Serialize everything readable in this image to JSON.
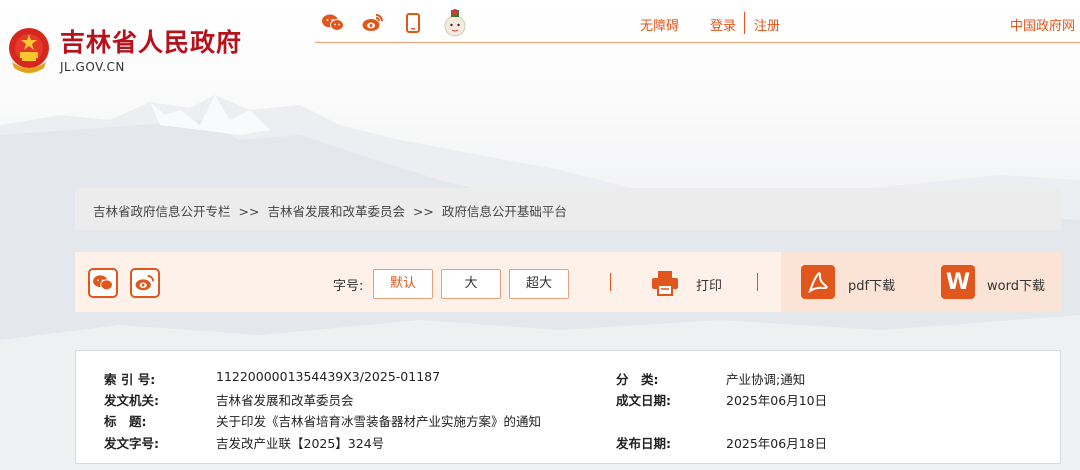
{
  "header": {
    "site_name": "吉林省人民政府",
    "domain": "JL.GOV.CN",
    "nav": {
      "accessibility": "无障碍",
      "login": "登录",
      "register": "注册",
      "central_gov": "中国政府网"
    },
    "social_icons": [
      "wechat-icon",
      "weibo-icon",
      "mobile-icon",
      "mascot-icon"
    ]
  },
  "breadcrumb": [
    "吉林省政府信息公开专栏",
    ">>",
    "吉林省发展和改革委员会",
    ">>",
    "政府信息公开基础平台"
  ],
  "toolbar": {
    "fontsize_label": "字号:",
    "fontsize_options": [
      "默认",
      "大",
      "超大"
    ],
    "print_label": "打印",
    "pdf_label": "pdf下载",
    "word_label": "word下载",
    "word_badge": "W"
  },
  "info": {
    "index_label": "索 引 号:",
    "index_value": "1122000001354439X3/2025-01187",
    "category_label": "分　类:",
    "category_value": "产业协调;通知",
    "issuer_label": "发文机关:",
    "issuer_value": "吉林省发展和改革委员会",
    "written_label": "成文日期:",
    "written_value": "2025年06月10日",
    "title_label": "标　题:",
    "title_value": "关于印发《吉林省培育冰雪装备器材产业实施方案》的通知",
    "docno_label": "发文字号:",
    "docno_value": "吉发改产业联【2025】324号",
    "published_label": "发布日期:",
    "published_value": "2025年06月18日"
  },
  "colors": {
    "brand_red": "#b5121b",
    "accent_orange": "#e0561d",
    "toolbar_bg": "#fdf1ea"
  }
}
